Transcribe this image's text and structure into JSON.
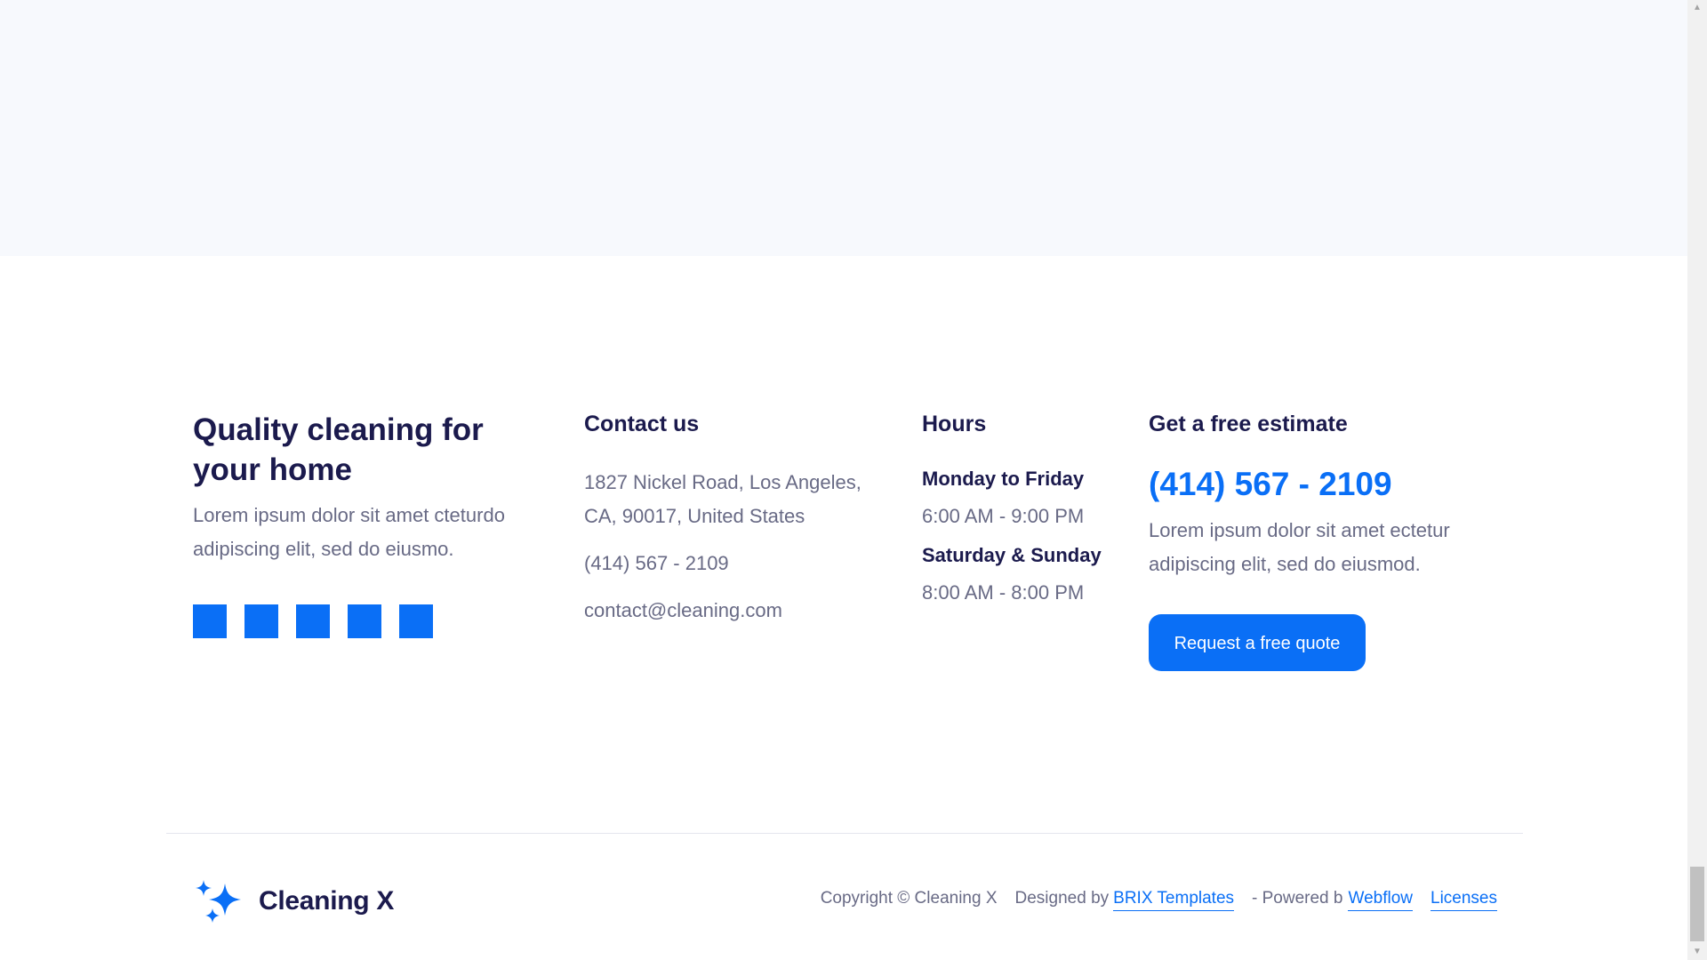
{
  "about": {
    "title": "Quality cleaning for your home",
    "description": "Lorem ipsum dolor sit amet cteturdo adipiscing elit, sed do eiusmo.",
    "social_icons": [
      "facebook-icon",
      "twitter-icon",
      "instagram-icon",
      "linkedin-icon",
      "youtube-icon"
    ]
  },
  "contact": {
    "heading": "Contact us",
    "address": "1827 Nickel Road, Los Angeles, CA, 90017, United States",
    "phone": "(414) 567 - 2109",
    "email": "contact@cleaning.com"
  },
  "hours": {
    "heading": "Hours",
    "weekday_label": "Monday to Friday",
    "weekday_hours": "6:00 AM - 9:00 PM",
    "weekend_label": "Saturday & Sunday",
    "weekend_hours": "8:00 AM - 8:00 PM"
  },
  "estimate": {
    "heading": "Get a free estimate",
    "phone": "(414) 567 - 2109",
    "description": "Lorem ipsum dolor sit amet ectetur adipiscing elit, sed do eiusmod.",
    "button_label": "Request a free quote"
  },
  "bottom_bar": {
    "logo_text": "Cleaning X",
    "copyright": "Copyright © Cleaning X",
    "designed_by_prefix": "Designed by",
    "designed_by_link": "BRIX Templates",
    "powered_by_prefix": "- Powered b",
    "powered_by_link": "Webflow",
    "licenses_link": "Licenses"
  },
  "colors": {
    "accent": "#0a6ff6",
    "heading": "#1b1a4d",
    "body_text": "#686a85",
    "top_band": "#f7f9fd"
  }
}
